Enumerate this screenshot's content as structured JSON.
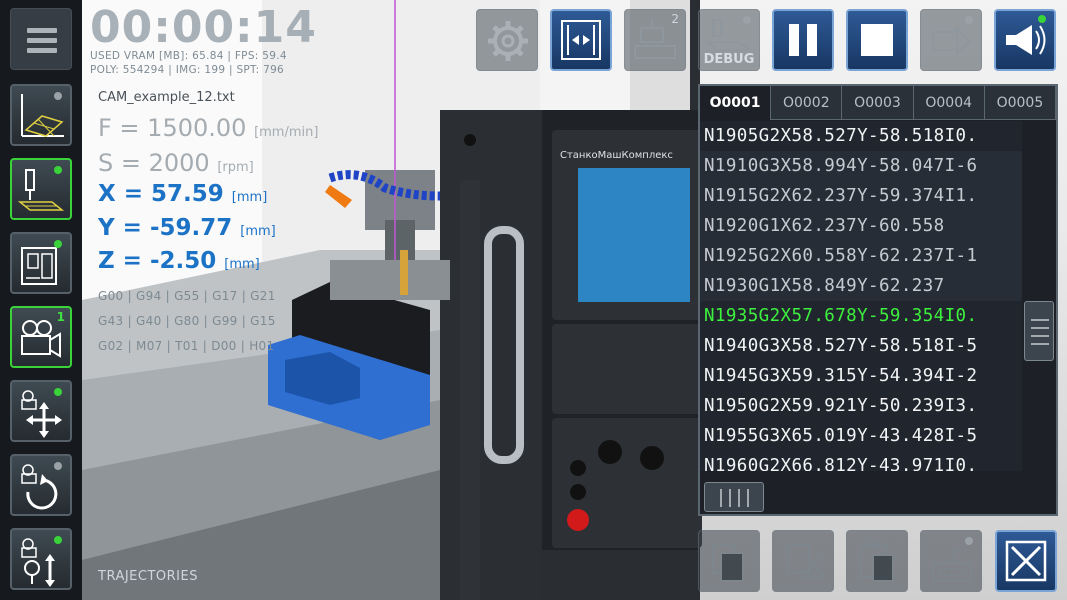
{
  "hud": {
    "timer": "00:00:14",
    "stats_line1": "USED VRAM [MB]: 65.84 | FPS: 59.4",
    "stats_line2": "POLY: 554294 | IMG: 199 | SPT: 796",
    "filename": "CAM_example_12.txt",
    "feed": {
      "label": "F = 1500.00",
      "unit": "[mm/min]"
    },
    "speed": {
      "label": "S = 2000",
      "unit": "[rpm]"
    },
    "x": {
      "label": "X = 57.59",
      "unit": "[mm]"
    },
    "y": {
      "label": "Y = -59.77",
      "unit": "[mm]"
    },
    "z": {
      "label": "Z = -2.50",
      "unit": "[mm]"
    },
    "gcodes": [
      "G00 | G94 | G55 | G17 | G21",
      "G43 | G40 | G80 | G99 | G15",
      "G02 | M07 | T01 | D00 | H01"
    ],
    "trajectories_label": "TRAJECTORIES"
  },
  "left_sidebar": {
    "items": [
      {
        "icon": "trajectory-grid-icon"
      },
      {
        "icon": "milling-tool-icon"
      },
      {
        "icon": "machine-icon"
      },
      {
        "icon": "camera-icon",
        "badge": "1"
      },
      {
        "icon": "move-arrows-icon"
      },
      {
        "icon": "camera-rotate-icon"
      },
      {
        "icon": "camera-zoom-icon"
      }
    ]
  },
  "toolbar": {
    "settings_icon": "gear-icon",
    "fit_icon": "fit-to-screen-icon",
    "machine_badge": "2",
    "debug_label": "DEBUG",
    "pause_icon": "pause-icon",
    "stop_icon": "stop-icon",
    "next_icon": "step-forward-icon",
    "sound_icon": "megaphone-icon"
  },
  "code_panel": {
    "tabs": [
      "O0001",
      "O0002",
      "O0003",
      "O0004",
      "O0005"
    ],
    "active_tab": 0,
    "lines": [
      "N1905G2X58.527Y-58.518I0.",
      "N1910G3X58.994Y-58.047I-6",
      "N1915G2X62.237Y-59.374I1.",
      "N1920G1X62.237Y-60.558",
      "N1925G2X60.558Y-62.237I-1",
      "N1930G1X58.849Y-62.237",
      "N1935G2X57.678Y-59.354I0.",
      "N1940G3X58.527Y-58.518I-5",
      "N1945G3X59.315Y-54.394I-2",
      "N1950G2X59.921Y-50.239I3.",
      "N1955G3X65.019Y-43.428I-5",
      "N1960G2X66.812Y-43.971I0."
    ],
    "current_line": 6
  },
  "colors": {
    "current_line": "#3ef03e",
    "axis_values": "#1c73c6",
    "accent_blue": "#2e5a96",
    "active_green": "#3ad43a"
  },
  "panel_branding": "СтанкоМашКомплекс"
}
